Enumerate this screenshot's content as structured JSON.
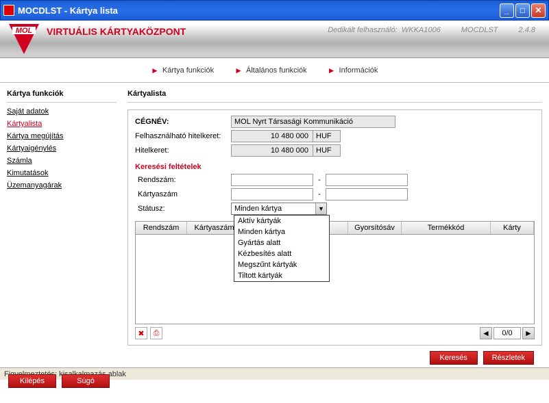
{
  "titlebar": {
    "title": "MOCDLST - Kártya lista"
  },
  "banner": {
    "title": "VIRTUÁLIS KÁRTYAKÖZPONT",
    "user_label": "Dedikált felhasználó:",
    "user": "WKKA1006",
    "app": "MOCDLST",
    "version": "2.4.8"
  },
  "topnav": {
    "item1": "Kártya funkciók",
    "item2": "Általános funkciók",
    "item3": "Információk"
  },
  "sidebar": {
    "title": "Kártya funkciók",
    "items": [
      "Saját adatok",
      "Kártyalista",
      "Kártya megújítás",
      "Kártyaigénylés",
      "Számla",
      "Kimutatások",
      "Üzemanyagárak"
    ]
  },
  "content": {
    "title": "Kártyalista"
  },
  "company": {
    "name_label": "CÉGNÉV:",
    "name": "MOL Nyrt Társasági Kommunikáció",
    "credit_used_label": "Felhasználható hitelkeret:",
    "credit_used": "10 480 000",
    "credit_label": "Hitelkeret:",
    "credit": "10 480 000",
    "currency": "HUF"
  },
  "search": {
    "title": "Keresési feltételek",
    "plate_label": "Rendszám:",
    "card_label": "Kártyaszám",
    "status_label": "Státusz:",
    "status_selected": "Minden kártya",
    "options": [
      "Aktív kártyák",
      "Minden kártya",
      "Gyártás alatt",
      "Kézbesítés alatt",
      "Megszűnt kártyák",
      "Tiltott kártyák"
    ],
    "dash": "-"
  },
  "table": {
    "cols": [
      "Rendszám",
      "Kártyaszám",
      "",
      "Gyorsítósáv",
      "Termékkód",
      "Kárty"
    ]
  },
  "pager": {
    "text": "0/0"
  },
  "buttons": {
    "exit": "Kilépés",
    "help": "Súgó",
    "search": "Keresés",
    "details": "Részletek"
  },
  "statusbar": {
    "text": "Figyelmeztetés: kisalkalmazás ablak"
  }
}
